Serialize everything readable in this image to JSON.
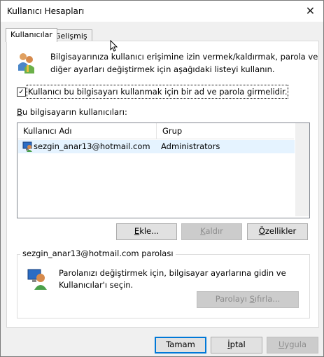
{
  "window": {
    "title": "Kullanıcı Hesapları",
    "close_glyph": "✕"
  },
  "tabs": [
    {
      "label": "Kullanıcılar",
      "active": true
    },
    {
      "label": "Gelişmiş",
      "active": false
    }
  ],
  "intro": {
    "line1": "Bilgisayarınıza kullanıcı erişimine izin vermek/kaldırmak, parola ve",
    "line2": "diğer ayarları değiştirmek için aşağıdaki listeyi kullanın."
  },
  "checkbox": {
    "label": "Kullanıcı bu bilgisayarı kullanmak için bir ad ve parola girmelidir.",
    "checked": true,
    "check_glyph": "✓"
  },
  "users_section": {
    "label_prefix": "B",
    "label_rest": "u bilgisayarın kullanıcıları:"
  },
  "table": {
    "columns": [
      "Kullanıcı Adı",
      "Grup"
    ],
    "rows": [
      {
        "name": "sezgin_anar13@hotmail.com",
        "group": "Administrators"
      }
    ]
  },
  "buttons": {
    "add": {
      "mnemonic": "E",
      "rest": "kle..."
    },
    "remove": {
      "mnemonic": "K",
      "rest": "aldır"
    },
    "properties": {
      "mnemonic": "Ö",
      "rest": "zellikler"
    }
  },
  "password_group": {
    "title": "sezgin_anar13@hotmail.com parolası",
    "line1": "Parolanızı değiştirmek için, bilgisayar ayarlarına gidin ve",
    "line2": "Kullanıcılar'ı seçin.",
    "reset_prefix": "Parolayı ",
    "reset_mnemonic": "S",
    "reset_rest": "ıfırla..."
  },
  "footer": {
    "ok": "Tamam",
    "cancel_mnemonic": "İ",
    "cancel_rest": "ptal",
    "apply_mnemonic": "U",
    "apply_rest": "ygula"
  },
  "colors": {
    "selection": "#e5f3ff",
    "default_button_border": "#0078d7"
  },
  "icons": [
    "users-icon",
    "user-monitor-icon",
    "user-badge-icon"
  ]
}
